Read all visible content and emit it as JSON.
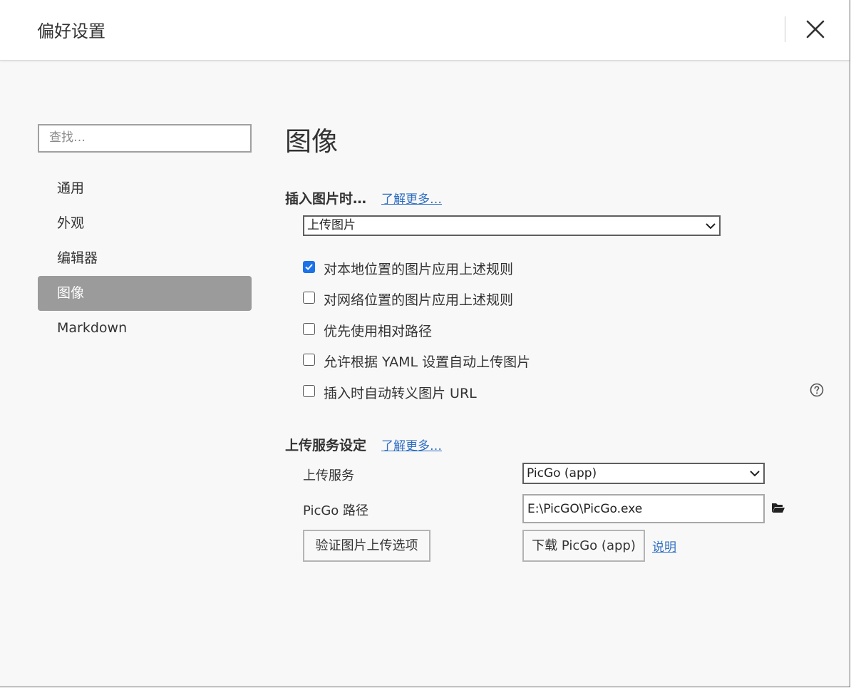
{
  "window": {
    "title": "偏好设置",
    "close_icon": "close-icon"
  },
  "sidebar": {
    "search_placeholder": "查找…",
    "items": [
      {
        "label": "通用",
        "active": false
      },
      {
        "label": "外观",
        "active": false
      },
      {
        "label": "编辑器",
        "active": false
      },
      {
        "label": "图像",
        "active": true
      },
      {
        "label": "Markdown",
        "active": false
      }
    ]
  },
  "main": {
    "heading": "图像",
    "insert_section": {
      "title": "插入图片时…",
      "learn_more": "了解更多…",
      "action_select_value": "上传图片",
      "options": [
        {
          "label": "对本地位置的图片应用上述规则",
          "checked": true
        },
        {
          "label": "对网络位置的图片应用上述规则",
          "checked": false
        },
        {
          "label": "优先使用相对路径",
          "checked": false
        },
        {
          "label": "允许根据 YAML 设置自动上传图片",
          "checked": false
        },
        {
          "label": "插入时自动转义图片 URL",
          "checked": false
        }
      ],
      "help_icon": "question-circle-icon"
    },
    "upload_section": {
      "title": "上传服务设定",
      "learn_more": "了解更多…",
      "service_label": "上传服务",
      "service_value": "PicGo (app)",
      "path_label": "PicGo 路径",
      "path_value": "E:\\PicGO\\PicGo.exe",
      "folder_icon": "folder-open-icon",
      "verify_button": "验证图片上传选项",
      "download_button": "下载 PicGo (app)",
      "help_link": "说明"
    }
  },
  "colors": {
    "accent": "#1a73e8",
    "link": "#2f6ec3",
    "sidebar_active_bg": "#9b9b9b",
    "content_bg": "#f8f8f8"
  }
}
